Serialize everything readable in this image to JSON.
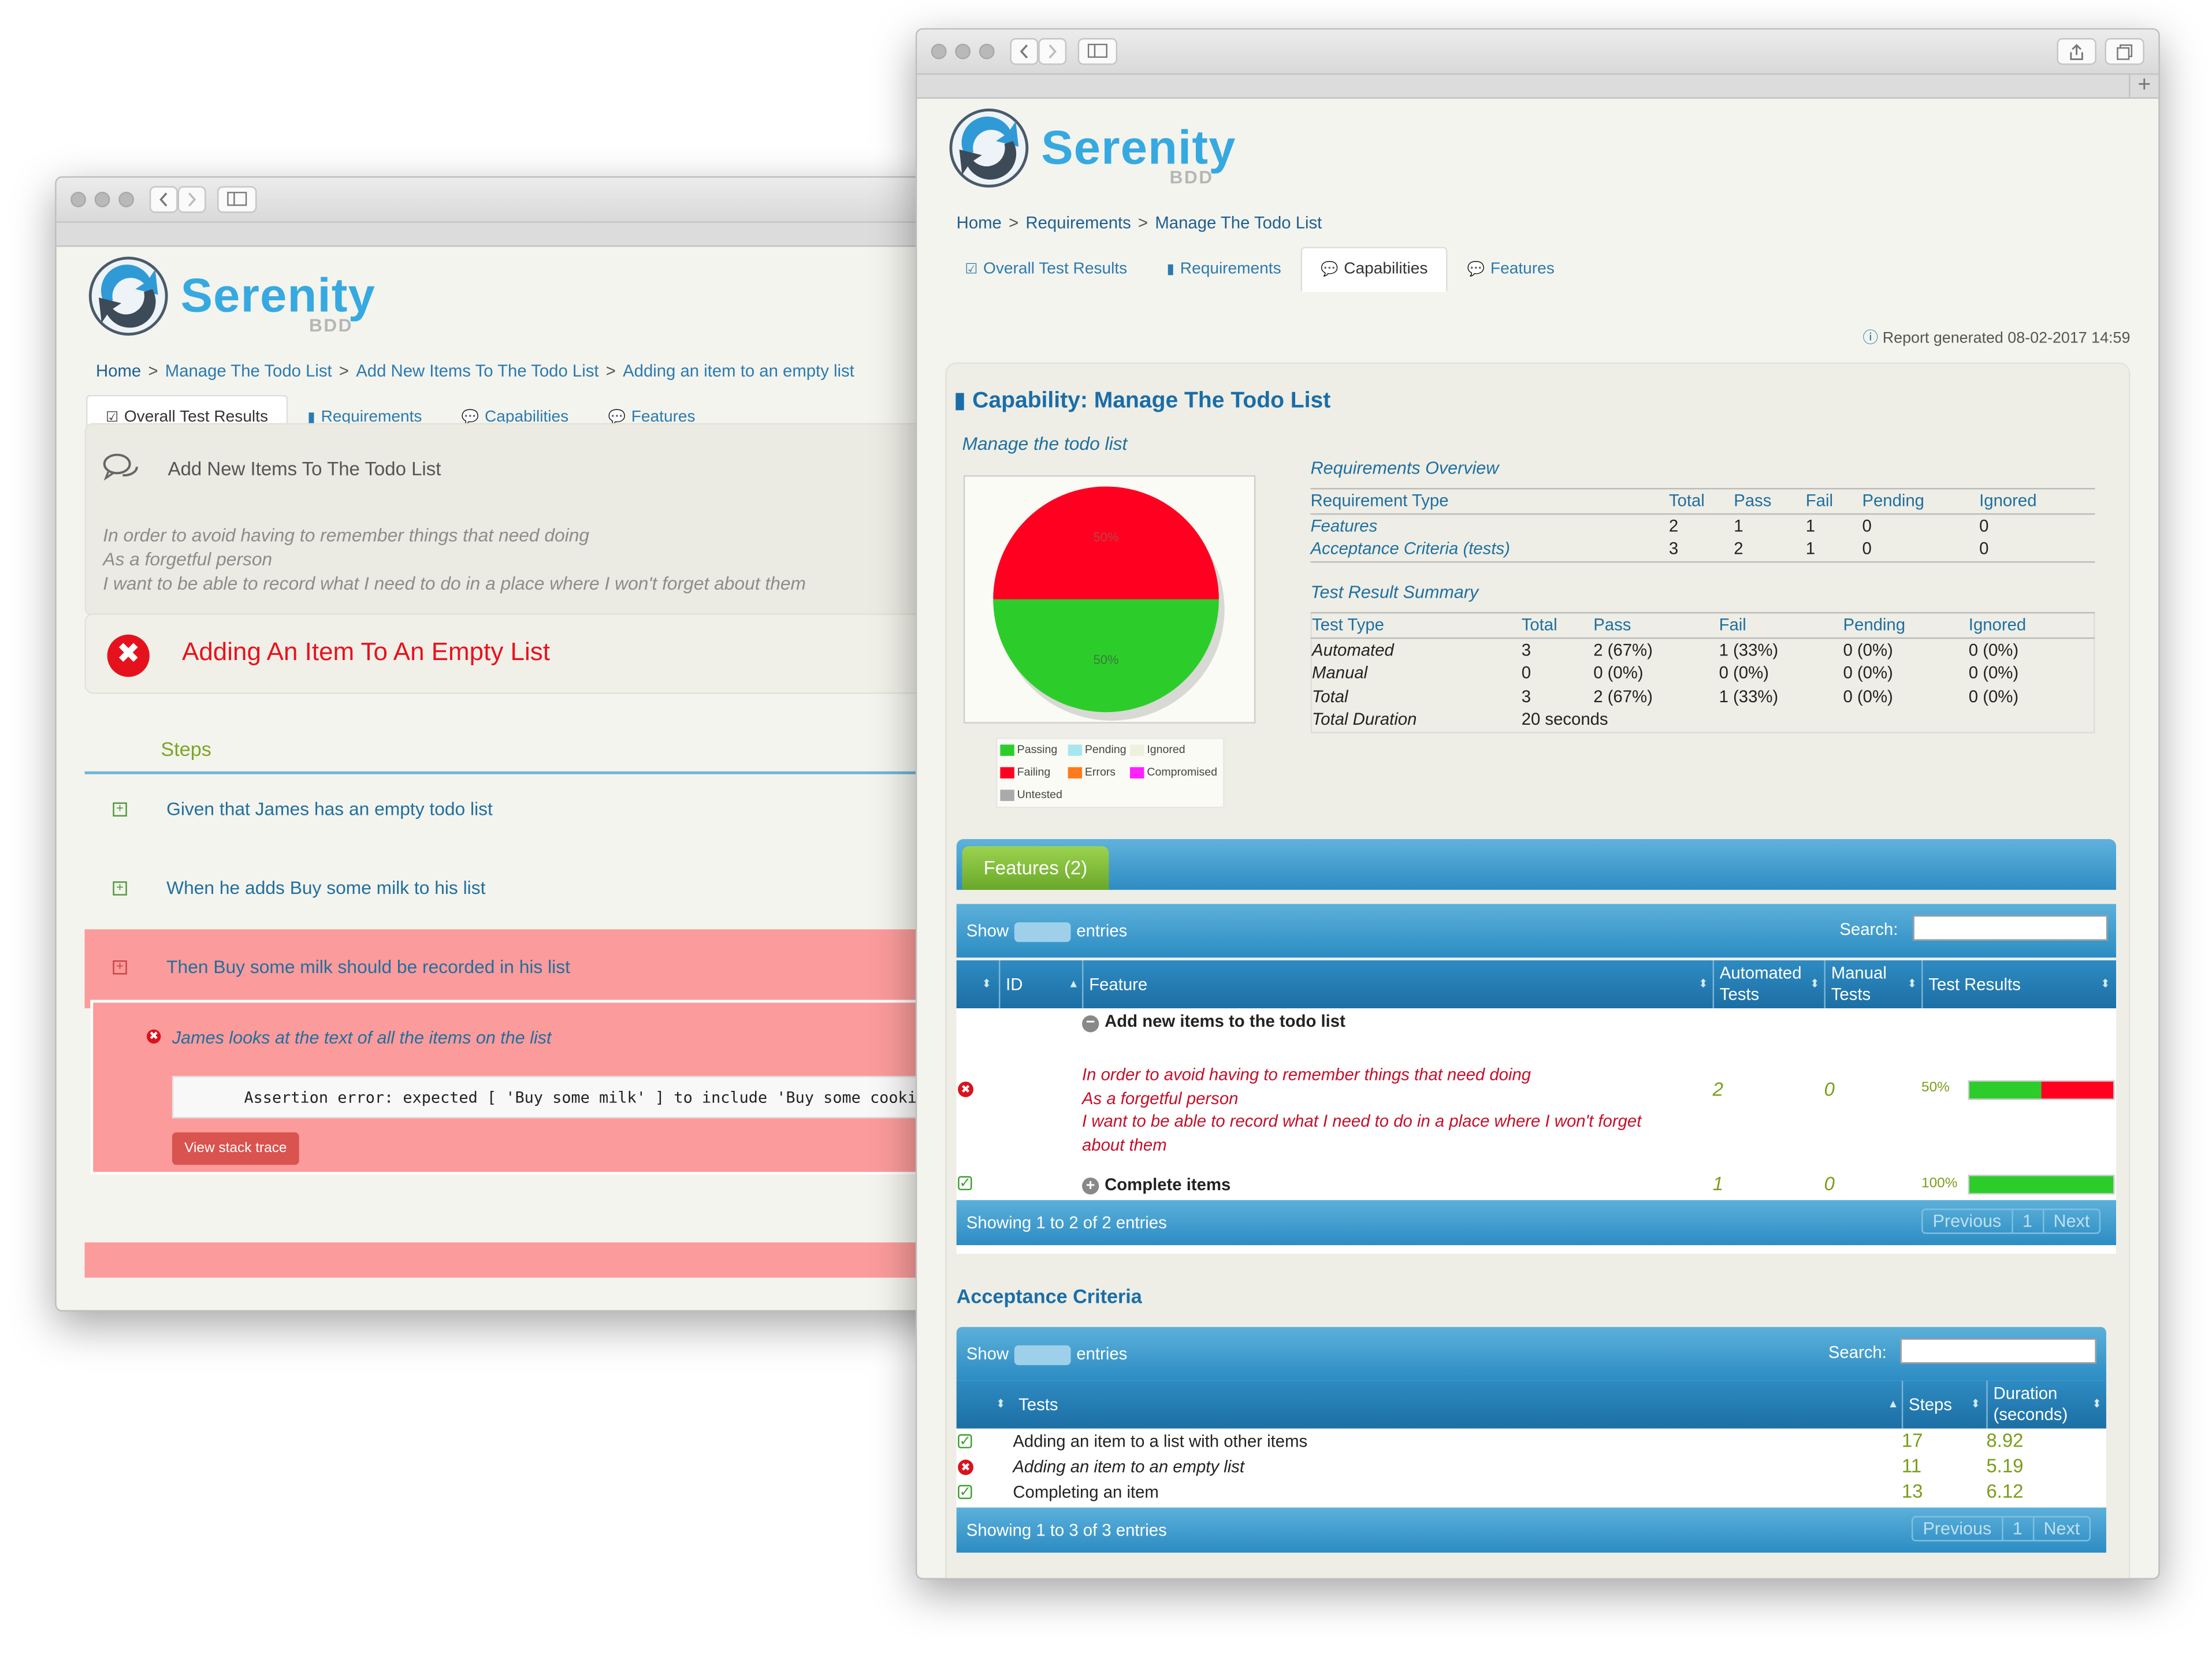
{
  "left_window": {
    "logo": {
      "word": "Serenity",
      "sub": "BDD"
    },
    "breadcrumb": [
      "Home",
      "Manage The Todo List",
      "Add New Items To The Todo List",
      "Adding an item to an empty list"
    ],
    "tabs": [
      "Overall Test Results",
      "Requirements",
      "Capabilities",
      "Features"
    ],
    "story": {
      "title": "Add New Items To The Todo List",
      "narrative": [
        "In order to avoid having to remember things that need doing",
        "As a forgetful person",
        "I want to be able to record what I need to do in a place where I won't forget about them"
      ]
    },
    "scenario_title": "Adding An Item To An Empty List",
    "steps_label": "Steps",
    "steps": [
      "Given that James has an empty todo list",
      "When he adds Buy some milk to his list",
      "Then Buy some milk should be recorded in his list"
    ],
    "substep": "James looks at the text of all the items on the list",
    "assertion": "Assertion error: expected [ 'Buy some milk' ] to include 'Buy some cookies'",
    "stack_button": "View stack trace"
  },
  "right_window": {
    "logo": {
      "word": "Serenity",
      "sub": "BDD"
    },
    "breadcrumb": [
      "Home",
      "Requirements",
      "Manage The Todo List"
    ],
    "tabs": [
      "Overall Test Results",
      "Requirements",
      "Capabilities",
      "Features"
    ],
    "report_generated": "Report generated 08-02-2017 14:59",
    "capability_title": "Capability: Manage The Todo List",
    "capability_sub": "Manage the todo list",
    "pie": {
      "fail_label": "50%",
      "pass_label": "50%",
      "fail_pct": 50,
      "pass_pct": 50,
      "fail_color": "#ff0020",
      "pass_color": "#2ccd2b"
    },
    "legend": [
      "Passing",
      "Pending",
      "Ignored",
      "Failing",
      "Errors",
      "Compromised",
      "Untested"
    ],
    "requirements_overview": {
      "label": "Requirements Overview",
      "headers": [
        "Requirement Type",
        "Total",
        "Pass",
        "Fail",
        "Pending",
        "Ignored"
      ],
      "rows": [
        [
          "Features",
          "2",
          "1",
          "1",
          "0",
          "0"
        ],
        [
          "Acceptance Criteria (tests)",
          "3",
          "2",
          "1",
          "0",
          "0"
        ]
      ]
    },
    "test_summary": {
      "label": "Test Result Summary",
      "headers": [
        "Test Type",
        "Total",
        "Pass",
        "Fail",
        "Pending",
        "Ignored"
      ],
      "rows": [
        [
          "Automated",
          "3",
          "2 (67%)",
          "1 (33%)",
          "0 (0%)",
          "0 (0%)"
        ],
        [
          "Manual",
          "0",
          "0 (0%)",
          "0 (0%)",
          "0 (0%)",
          "0 (0%)"
        ],
        [
          "Total",
          "3",
          "2 (67%)",
          "1 (33%)",
          "0 (0%)",
          "0 (0%)"
        ],
        [
          "Total Duration",
          "20 seconds",
          "",
          "",
          "",
          ""
        ]
      ]
    },
    "features": {
      "tab": "Features (2)",
      "show": "Show",
      "entries": "entries",
      "search": "Search:",
      "headers": [
        "ID",
        "Feature",
        "Automated Tests",
        "Manual Tests",
        "Test Results"
      ],
      "rows": [
        {
          "name": "Add new items to the todo list",
          "narrative": [
            "In order to avoid having to remember things that need doing",
            "As a forgetful person",
            "I want to be able to record what I need to do in a place where I won't forget",
            "about them"
          ],
          "automated": "2",
          "manual": "0",
          "result": "50%",
          "pass_frac": 0.5
        },
        {
          "name": "Complete items",
          "automated": "1",
          "manual": "0",
          "result": "100%",
          "pass_frac": 1.0
        }
      ],
      "footer": "Showing 1 to 2 of 2 entries",
      "pager": [
        "Previous",
        "1",
        "Next"
      ]
    },
    "acceptance": {
      "title": "Acceptance Criteria",
      "show": "Show",
      "entries": "entries",
      "search": "Search:",
      "headers": [
        "Tests",
        "Steps",
        "Duration (seconds)"
      ],
      "rows": [
        {
          "name": "Adding an item to a list with other items",
          "steps": "17",
          "duration": "8.92",
          "status": "pass"
        },
        {
          "name": "Adding an item to an empty list",
          "steps": "11",
          "duration": "5.19",
          "status": "fail"
        },
        {
          "name": "Completing an item",
          "steps": "13",
          "duration": "6.12",
          "status": "pass"
        }
      ],
      "footer": "Showing 1 to 3 of 3 entries",
      "pager": [
        "Previous",
        "1",
        "Next"
      ]
    }
  }
}
